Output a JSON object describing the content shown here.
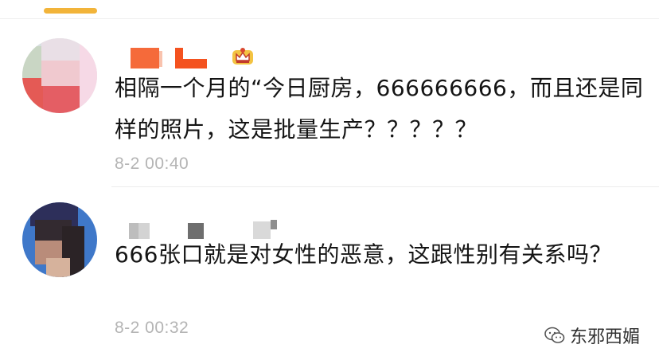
{
  "comments": [
    {
      "text": "相隔一个月的“今日厨房，666666666，而且还是同样的照片，这是批量生产？？？？？",
      "time": "8-2 00:40",
      "badge": "crown-icon"
    },
    {
      "text": "666张口就是对女性的恶意，这跟性别有关系吗？",
      "time": "8-2 00:32"
    }
  ],
  "watermark": {
    "icon": "wechat-icon",
    "text": "东邪西媚"
  },
  "colors": {
    "accent": "#f2b43a",
    "timestamp": "#b4b4b4",
    "text": "#141414"
  }
}
